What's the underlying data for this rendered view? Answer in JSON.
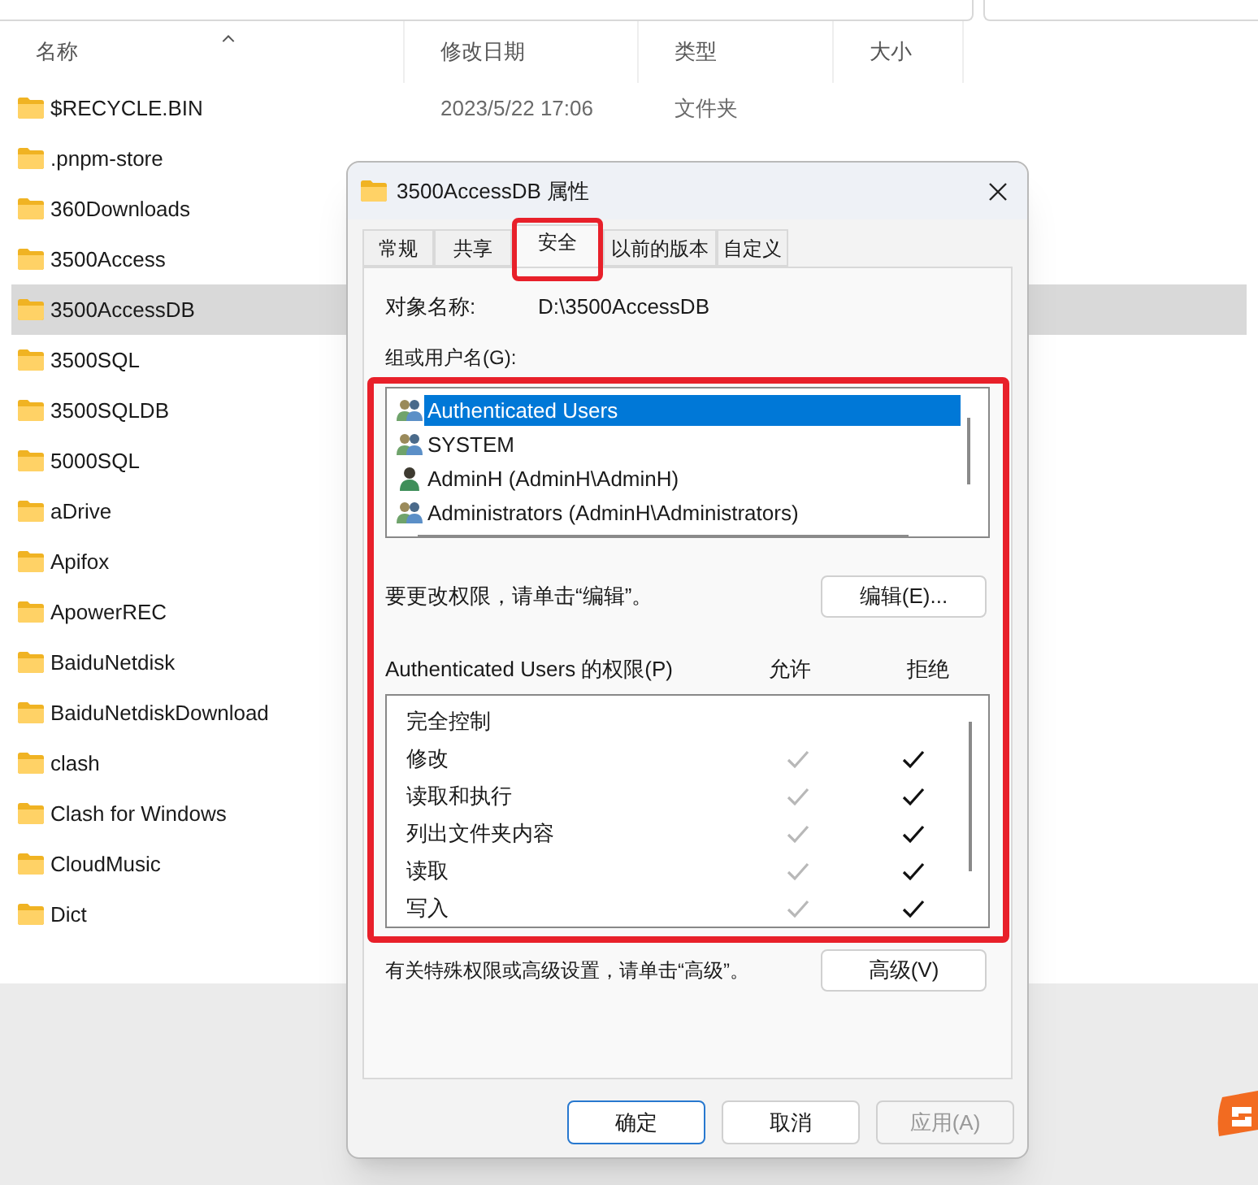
{
  "explorer": {
    "columns": [
      {
        "label": "名称"
      },
      {
        "label": "修改日期"
      },
      {
        "label": "类型"
      },
      {
        "label": "大小"
      }
    ],
    "rows": [
      {
        "name": "$RECYCLE.BIN",
        "date": "2023/5/22 17:06",
        "type": "文件夹",
        "selected": false
      },
      {
        "name": ".pnpm-store",
        "selected": false
      },
      {
        "name": "360Downloads",
        "selected": false
      },
      {
        "name": "3500Access",
        "selected": false
      },
      {
        "name": "3500AccessDB",
        "selected": true
      },
      {
        "name": "3500SQL",
        "selected": false
      },
      {
        "name": "3500SQLDB",
        "selected": false
      },
      {
        "name": "5000SQL",
        "selected": false
      },
      {
        "name": "aDrive",
        "selected": false
      },
      {
        "name": "Apifox",
        "selected": false
      },
      {
        "name": "ApowerREC",
        "selected": false
      },
      {
        "name": "BaiduNetdisk",
        "selected": false
      },
      {
        "name": "BaiduNetdiskDownload",
        "selected": false
      },
      {
        "name": "clash",
        "selected": false
      },
      {
        "name": "Clash for Windows",
        "selected": false
      },
      {
        "name": "CloudMusic",
        "selected": false
      },
      {
        "name": "Dict",
        "selected": false
      }
    ]
  },
  "dialog": {
    "title": "3500AccessDB 属性",
    "tabs": [
      {
        "label": "常规",
        "selected": false
      },
      {
        "label": "共享",
        "selected": false
      },
      {
        "label": "安全",
        "selected": true
      },
      {
        "label": "以前的版本",
        "selected": false
      },
      {
        "label": "自定义",
        "selected": false
      }
    ],
    "object_name_label": "对象名称:",
    "object_name_value": "D:\\3500AccessDB",
    "group_label": "组或用户名(G):",
    "users": [
      {
        "name": "Authenticated Users",
        "kind": "group",
        "selected": true
      },
      {
        "name": "SYSTEM",
        "kind": "group",
        "selected": false
      },
      {
        "name": "AdminH (AdminH\\AdminH)",
        "kind": "user",
        "selected": false
      },
      {
        "name": "Administrators (AdminH\\Administrators)",
        "kind": "group",
        "selected": false
      }
    ],
    "edit_hint": "要更改权限，请单击“编辑”。",
    "edit_button": "编辑(E)...",
    "permissions_label": "Authenticated Users 的权限(P)",
    "allow_header": "允许",
    "deny_header": "拒绝",
    "permissions": [
      {
        "name": "完全控制",
        "allow": false,
        "deny": false
      },
      {
        "name": "修改",
        "allow": true,
        "allow_inherited": true,
        "deny": true,
        "deny_inherited": false
      },
      {
        "name": "读取和执行",
        "allow": true,
        "allow_inherited": true,
        "deny": true,
        "deny_inherited": false
      },
      {
        "name": "列出文件夹内容",
        "allow": true,
        "allow_inherited": true,
        "deny": true,
        "deny_inherited": false
      },
      {
        "name": "读取",
        "allow": true,
        "allow_inherited": true,
        "deny": true,
        "deny_inherited": false
      },
      {
        "name": "写入",
        "allow": true,
        "allow_inherited": true,
        "deny": true,
        "deny_inherited": false
      }
    ],
    "advanced_hint": "有关特殊权限或高级设置，请单击“高级”。",
    "advanced_button": "高级(V)",
    "buttons": [
      {
        "label": "确定",
        "kind": "default",
        "disabled": false
      },
      {
        "label": "取消",
        "kind": "normal",
        "disabled": false
      },
      {
        "label": "应用(A)",
        "kind": "normal",
        "disabled": true
      }
    ]
  }
}
